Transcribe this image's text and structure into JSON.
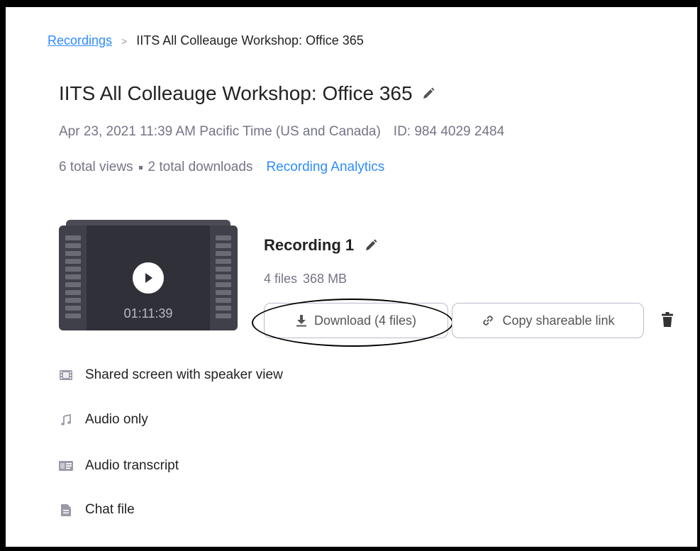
{
  "breadcrumb": {
    "root": "Recordings",
    "separator": ">",
    "current": "IITS All Colleauge Workshop: Office 365"
  },
  "meeting": {
    "title": "IITS All Colleauge Workshop: Office 365",
    "datetime": "Apr 23, 2021 11:39 AM Pacific Time (US and Canada)",
    "id": "ID: 984 4029 2484",
    "views": "6 total views",
    "downloads": "2 total downloads",
    "analytics_link": "Recording Analytics"
  },
  "recording": {
    "title": "Recording 1",
    "files": "4 files",
    "size": "368 MB",
    "duration": "01:11:39",
    "download_label": "Download (4 files)",
    "copy_label": "Copy shareable link"
  },
  "files": [
    {
      "label": "Shared screen with speaker view",
      "icon": "video-file-icon"
    },
    {
      "label": "Audio only",
      "icon": "music-note-icon"
    },
    {
      "label": "Audio transcript",
      "icon": "transcript-icon"
    },
    {
      "label": "Chat file",
      "icon": "document-icon"
    }
  ],
  "colors": {
    "link": "#2d8cff",
    "muted_text": "#747487",
    "thumbnail": "#3f4049"
  }
}
